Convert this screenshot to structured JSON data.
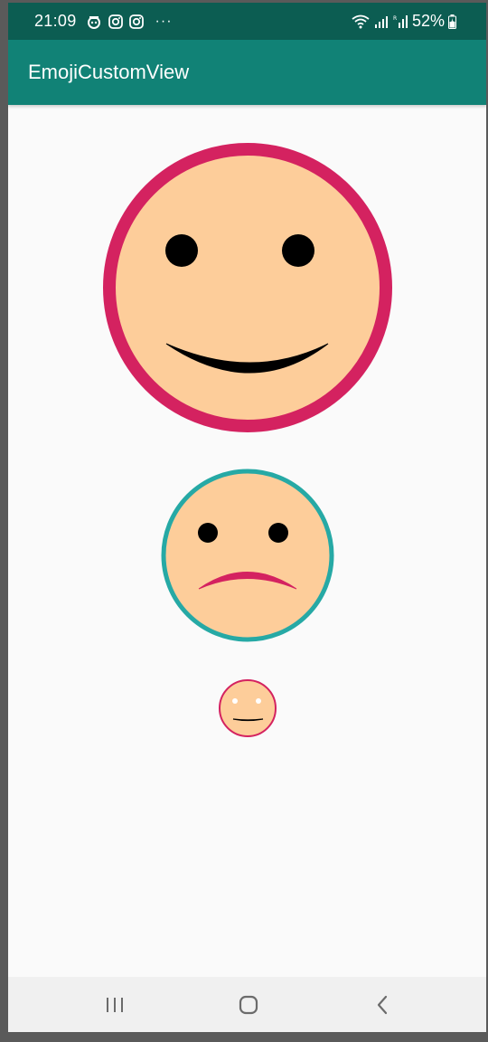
{
  "status_bar": {
    "time": "21:09",
    "left_icons": [
      "notification-icon",
      "instagram-icon",
      "instagram-icon"
    ],
    "more": "···",
    "right_icons": [
      "wifi-icon",
      "signal-icon",
      "roaming-signal-icon"
    ],
    "battery": "52%"
  },
  "app_bar": {
    "title": "EmojiCustomView"
  },
  "emojis": [
    {
      "mood": "happy",
      "face_color": "#fdcd9a",
      "border_color": "#d42260",
      "eye_color": "#000000",
      "mouth_color": "#000000"
    },
    {
      "mood": "sad",
      "face_color": "#fdcd9a",
      "border_color": "#26a9a5",
      "eye_color": "#000000",
      "mouth_color": "#d42260"
    },
    {
      "mood": "neutral",
      "face_color": "#fdcd9a",
      "border_color": "#d42260",
      "eye_color": "#ffffff",
      "mouth_color": "#000000"
    }
  ],
  "nav_bar": {
    "buttons": [
      "recent-apps-icon",
      "home-icon",
      "back-icon"
    ]
  },
  "colors": {
    "status_bar": "#0c5d52",
    "app_bar": "#118276",
    "background": "#fafafa"
  }
}
